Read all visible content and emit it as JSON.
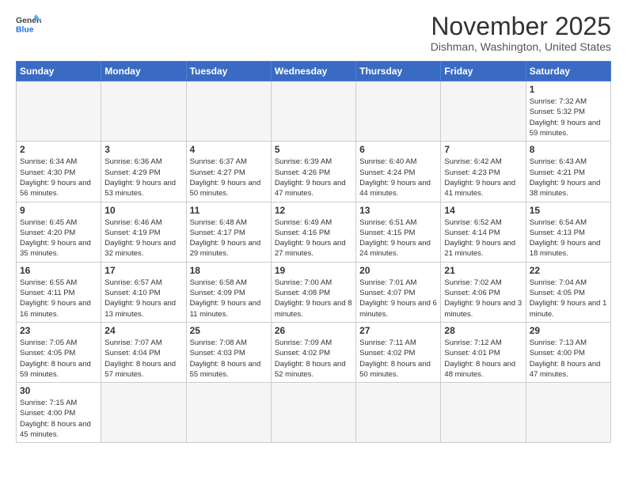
{
  "header": {
    "logo_general": "General",
    "logo_blue": "Blue",
    "month_title": "November 2025",
    "location": "Dishman, Washington, United States"
  },
  "days_of_week": [
    "Sunday",
    "Monday",
    "Tuesday",
    "Wednesday",
    "Thursday",
    "Friday",
    "Saturday"
  ],
  "weeks": [
    [
      {
        "day": "",
        "info": ""
      },
      {
        "day": "",
        "info": ""
      },
      {
        "day": "",
        "info": ""
      },
      {
        "day": "",
        "info": ""
      },
      {
        "day": "",
        "info": ""
      },
      {
        "day": "",
        "info": ""
      },
      {
        "day": "1",
        "info": "Sunrise: 7:32 AM\nSunset: 5:32 PM\nDaylight: 9 hours and 59 minutes."
      }
    ],
    [
      {
        "day": "2",
        "info": "Sunrise: 6:34 AM\nSunset: 4:30 PM\nDaylight: 9 hours and 56 minutes."
      },
      {
        "day": "3",
        "info": "Sunrise: 6:36 AM\nSunset: 4:29 PM\nDaylight: 9 hours and 53 minutes."
      },
      {
        "day": "4",
        "info": "Sunrise: 6:37 AM\nSunset: 4:27 PM\nDaylight: 9 hours and 50 minutes."
      },
      {
        "day": "5",
        "info": "Sunrise: 6:39 AM\nSunset: 4:26 PM\nDaylight: 9 hours and 47 minutes."
      },
      {
        "day": "6",
        "info": "Sunrise: 6:40 AM\nSunset: 4:24 PM\nDaylight: 9 hours and 44 minutes."
      },
      {
        "day": "7",
        "info": "Sunrise: 6:42 AM\nSunset: 4:23 PM\nDaylight: 9 hours and 41 minutes."
      },
      {
        "day": "8",
        "info": "Sunrise: 6:43 AM\nSunset: 4:21 PM\nDaylight: 9 hours and 38 minutes."
      }
    ],
    [
      {
        "day": "9",
        "info": "Sunrise: 6:45 AM\nSunset: 4:20 PM\nDaylight: 9 hours and 35 minutes."
      },
      {
        "day": "10",
        "info": "Sunrise: 6:46 AM\nSunset: 4:19 PM\nDaylight: 9 hours and 32 minutes."
      },
      {
        "day": "11",
        "info": "Sunrise: 6:48 AM\nSunset: 4:17 PM\nDaylight: 9 hours and 29 minutes."
      },
      {
        "day": "12",
        "info": "Sunrise: 6:49 AM\nSunset: 4:16 PM\nDaylight: 9 hours and 27 minutes."
      },
      {
        "day": "13",
        "info": "Sunrise: 6:51 AM\nSunset: 4:15 PM\nDaylight: 9 hours and 24 minutes."
      },
      {
        "day": "14",
        "info": "Sunrise: 6:52 AM\nSunset: 4:14 PM\nDaylight: 9 hours and 21 minutes."
      },
      {
        "day": "15",
        "info": "Sunrise: 6:54 AM\nSunset: 4:13 PM\nDaylight: 9 hours and 18 minutes."
      }
    ],
    [
      {
        "day": "16",
        "info": "Sunrise: 6:55 AM\nSunset: 4:11 PM\nDaylight: 9 hours and 16 minutes."
      },
      {
        "day": "17",
        "info": "Sunrise: 6:57 AM\nSunset: 4:10 PM\nDaylight: 9 hours and 13 minutes."
      },
      {
        "day": "18",
        "info": "Sunrise: 6:58 AM\nSunset: 4:09 PM\nDaylight: 9 hours and 11 minutes."
      },
      {
        "day": "19",
        "info": "Sunrise: 7:00 AM\nSunset: 4:08 PM\nDaylight: 9 hours and 8 minutes."
      },
      {
        "day": "20",
        "info": "Sunrise: 7:01 AM\nSunset: 4:07 PM\nDaylight: 9 hours and 6 minutes."
      },
      {
        "day": "21",
        "info": "Sunrise: 7:02 AM\nSunset: 4:06 PM\nDaylight: 9 hours and 3 minutes."
      },
      {
        "day": "22",
        "info": "Sunrise: 7:04 AM\nSunset: 4:05 PM\nDaylight: 9 hours and 1 minute."
      }
    ],
    [
      {
        "day": "23",
        "info": "Sunrise: 7:05 AM\nSunset: 4:05 PM\nDaylight: 8 hours and 59 minutes."
      },
      {
        "day": "24",
        "info": "Sunrise: 7:07 AM\nSunset: 4:04 PM\nDaylight: 8 hours and 57 minutes."
      },
      {
        "day": "25",
        "info": "Sunrise: 7:08 AM\nSunset: 4:03 PM\nDaylight: 8 hours and 55 minutes."
      },
      {
        "day": "26",
        "info": "Sunrise: 7:09 AM\nSunset: 4:02 PM\nDaylight: 8 hours and 52 minutes."
      },
      {
        "day": "27",
        "info": "Sunrise: 7:11 AM\nSunset: 4:02 PM\nDaylight: 8 hours and 50 minutes."
      },
      {
        "day": "28",
        "info": "Sunrise: 7:12 AM\nSunset: 4:01 PM\nDaylight: 8 hours and 48 minutes."
      },
      {
        "day": "29",
        "info": "Sunrise: 7:13 AM\nSunset: 4:00 PM\nDaylight: 8 hours and 47 minutes."
      }
    ],
    [
      {
        "day": "30",
        "info": "Sunrise: 7:15 AM\nSunset: 4:00 PM\nDaylight: 8 hours and 45 minutes."
      },
      {
        "day": "",
        "info": ""
      },
      {
        "day": "",
        "info": ""
      },
      {
        "day": "",
        "info": ""
      },
      {
        "day": "",
        "info": ""
      },
      {
        "day": "",
        "info": ""
      },
      {
        "day": "",
        "info": ""
      }
    ]
  ]
}
